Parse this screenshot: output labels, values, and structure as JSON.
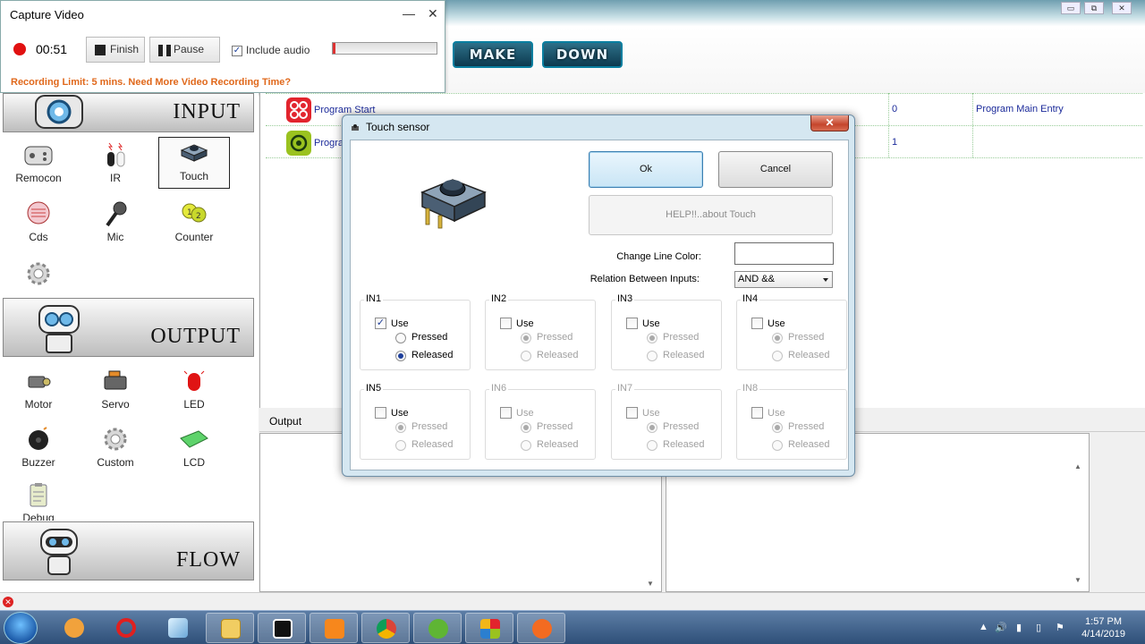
{
  "app": {
    "toolbar": {
      "make_label": "MAKE",
      "down_label": "DOWN"
    },
    "window_controls": {
      "minimize": "▭",
      "restore": "⧉",
      "close": "✕"
    }
  },
  "capture": {
    "title": "Capture Video",
    "minimize": "—",
    "close": "✕",
    "timer": "00:51",
    "finish_label": "Finish",
    "pause_label": "Pause",
    "include_audio_label": "Include audio",
    "include_audio_checked": true,
    "audio_level": 0.03,
    "limit_text": "Recording Limit: 5 mins. Need More Video Recording Time?",
    "rec_color": "#e11111",
    "limit_color": "#e0681b"
  },
  "sidebar": {
    "input_header": "INPUT",
    "output_header": "OUTPUT",
    "flow_header": "FLOW",
    "input_items": [
      {
        "label": "Remocon",
        "icon": "remote-icon"
      },
      {
        "label": "IR",
        "icon": "ir-sensor-icon"
      },
      {
        "label": "Touch",
        "icon": "touch-sensor-icon",
        "selected": true
      },
      {
        "label": "Cds",
        "icon": "cds-sensor-icon"
      },
      {
        "label": "Mic",
        "icon": "microphone-icon"
      },
      {
        "label": "Counter",
        "icon": "counter-icon"
      },
      {
        "label": "",
        "icon": "gear-icon"
      }
    ],
    "output_items": [
      {
        "label": "Motor",
        "icon": "motor-icon"
      },
      {
        "label": "Servo",
        "icon": "servo-icon"
      },
      {
        "label": "LED",
        "icon": "led-icon"
      },
      {
        "label": "Buzzer",
        "icon": "buzzer-icon"
      },
      {
        "label": "Custom",
        "icon": "gear-icon"
      },
      {
        "label": "LCD",
        "icon": "lcd-icon"
      },
      {
        "label": "Debug",
        "icon": "clipboard-icon"
      }
    ]
  },
  "program": {
    "rows": [
      {
        "name": "Program Start",
        "num": "0",
        "desc": "Program Main Entry"
      },
      {
        "name": "Progra",
        "num": "1",
        "desc": ""
      }
    ]
  },
  "output": {
    "label": "Output"
  },
  "dialog": {
    "title": "Touch sensor",
    "close": "✕",
    "ok_label": "Ok",
    "cancel_label": "Cancel",
    "help_label": "HELP!!..about Touch",
    "change_color_label": "Change Line Color:",
    "relation_label": "Relation Between Inputs:",
    "relation_value": "AND &&",
    "use_label": "Use",
    "pressed_label": "Pressed",
    "released_label": "Released",
    "inputs": [
      {
        "name": "IN1",
        "enabled": true,
        "use": true,
        "pressed": false,
        "released": true
      },
      {
        "name": "IN2",
        "enabled": true,
        "use": false,
        "pressed": true,
        "released": false
      },
      {
        "name": "IN3",
        "enabled": true,
        "use": false,
        "pressed": true,
        "released": false
      },
      {
        "name": "IN4",
        "enabled": true,
        "use": false,
        "pressed": true,
        "released": false
      },
      {
        "name": "IN5",
        "enabled": true,
        "use": false,
        "pressed": true,
        "released": false
      },
      {
        "name": "IN6",
        "enabled": false,
        "use": false,
        "pressed": true,
        "released": false
      },
      {
        "name": "IN7",
        "enabled": false,
        "use": false,
        "pressed": true,
        "released": false
      },
      {
        "name": "IN8",
        "enabled": false,
        "use": false,
        "pressed": true,
        "released": false
      }
    ]
  },
  "taskbar": {
    "items": [
      {
        "icon": "windows-start-icon"
      },
      {
        "icon": "media-player-icon"
      },
      {
        "icon": "opera-browser-icon"
      },
      {
        "icon": "notepad-icon"
      },
      {
        "icon": "file-explorer-icon"
      },
      {
        "icon": "intellij-icon"
      },
      {
        "icon": "sublime-text-icon"
      },
      {
        "icon": "chrome-icon"
      },
      {
        "icon": "utorrent-icon"
      },
      {
        "icon": "robot-app-icon"
      },
      {
        "icon": "screen-recorder-icon"
      }
    ],
    "time": "1:57 PM",
    "date": "4/14/2019"
  }
}
